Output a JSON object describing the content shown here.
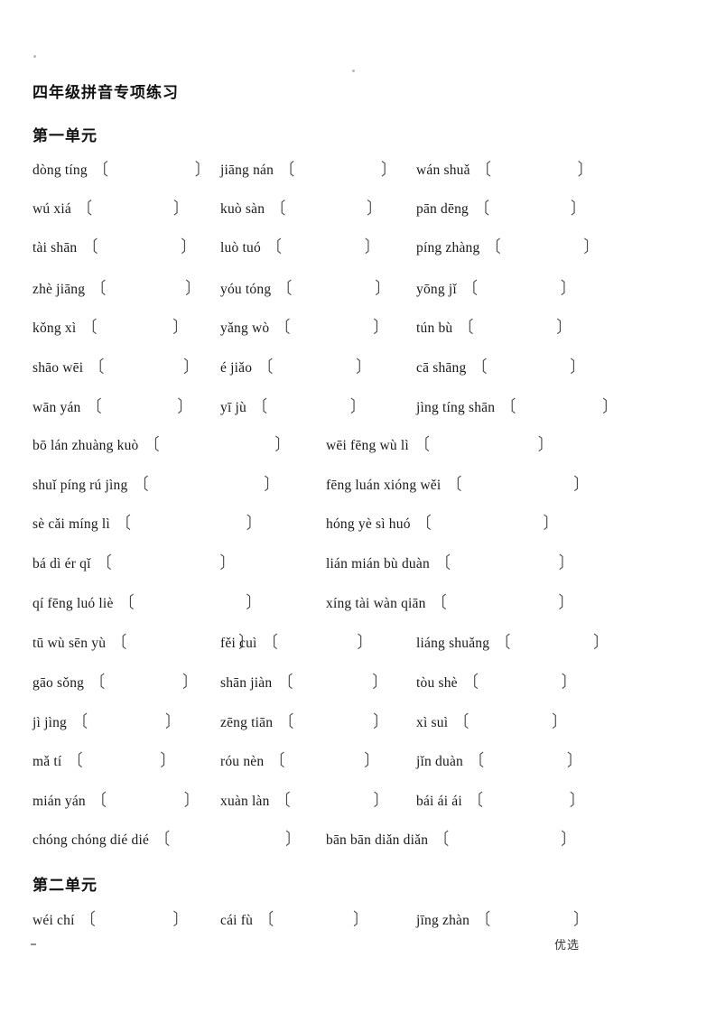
{
  "document": {
    "title": "四年级拼音专项练习",
    "footer_mark": "优选",
    "bracket_left": "〔",
    "bracket_right": "〕"
  },
  "units": [
    {
      "heading": "第一单元"
    },
    {
      "heading": "第二单元"
    }
  ],
  "rows": [
    {
      "items": [
        {
          "pinyin": "dòng tíng",
          "blank_width": 96
        },
        {
          "pinyin": "jiāng nán",
          "blank_width": 96
        },
        {
          "pinyin": "wán shuǎ",
          "blank_width": 96
        }
      ]
    },
    {
      "items": [
        {
          "pinyin": "wú xiá",
          "blank_width": 90
        },
        {
          "pinyin": "kuò sàn",
          "blank_width": 90
        },
        {
          "pinyin": "pān dēng",
          "blank_width": 90
        }
      ]
    },
    {
      "items": [
        {
          "pinyin": "tài shān",
          "blank_width": 92
        },
        {
          "pinyin": "luò tuó",
          "blank_width": 92
        },
        {
          "pinyin": "píng zhàng",
          "blank_width": 92
        }
      ]
    },
    {
      "items": [
        {
          "pinyin": "zhè jiāng",
          "blank_width": 88
        },
        {
          "pinyin": "yóu tóng",
          "blank_width": 92
        },
        {
          "pinyin": "yōng jǐ",
          "blank_width": 92
        }
      ]
    },
    {
      "items": [
        {
          "pinyin": "kǒng xì",
          "blank_width": 84
        },
        {
          "pinyin": "yǎng wò",
          "blank_width": 92
        },
        {
          "pinyin": "tún bù",
          "blank_width": 92
        }
      ]
    },
    {
      "items": [
        {
          "pinyin": "shāo wēi",
          "blank_width": 88
        },
        {
          "pinyin": "é jiǎo",
          "blank_width": 92
        },
        {
          "pinyin": "cā shāng",
          "blank_width": 92
        }
      ]
    },
    {
      "items": [
        {
          "pinyin": "wān yán",
          "blank_width": 84
        },
        {
          "pinyin": "yī jù",
          "blank_width": 92
        },
        {
          "pinyin": "jìng tíng shān",
          "blank_width": 96
        }
      ]
    },
    {
      "items": [
        {
          "pinyin": "bō lán zhuàng kuò",
          "blank_width": 128
        },
        {
          "pinyin": "wēi fēng wù lì",
          "blank_width": 120
        }
      ]
    },
    {
      "items": [
        {
          "pinyin": "shuǐ píng rú jìng",
          "blank_width": 128
        },
        {
          "pinyin": "fēng luán xióng wěi",
          "blank_width": 124
        }
      ]
    },
    {
      "items": [
        {
          "pinyin": "sè cǎi míng lì",
          "blank_width": 128
        },
        {
          "pinyin": "hóng yè sì huó",
          "blank_width": 124
        }
      ]
    },
    {
      "items": [
        {
          "pinyin": "bá dì ér qǐ",
          "blank_width": 120
        },
        {
          "pinyin": "lián mián bù duàn",
          "blank_width": 120
        }
      ]
    },
    {
      "items": [
        {
          "pinyin": "qí fēng luó liè",
          "blank_width": 124
        },
        {
          "pinyin": "xíng tài wàn qiān",
          "blank_width": 124
        }
      ]
    },
    {
      "items": [
        {
          "pinyin": "tū wù sēn yù",
          "blank_width": 124
        },
        {
          "pinyin": "fěi cuì",
          "blank_width": 88
        },
        {
          "pinyin": "liáng shuǎng",
          "blank_width": 92
        }
      ]
    },
    {
      "items": [
        {
          "pinyin": "gāo sǒng",
          "blank_width": 86
        },
        {
          "pinyin": "shān jiàn",
          "blank_width": 88
        },
        {
          "pinyin": "tòu shè",
          "blank_width": 92
        }
      ]
    },
    {
      "items": [
        {
          "pinyin": "jì jìng",
          "blank_width": 86
        },
        {
          "pinyin": "zēng tiān",
          "blank_width": 88
        },
        {
          "pinyin": "xì suì",
          "blank_width": 92
        }
      ]
    },
    {
      "items": [
        {
          "pinyin": "mǎ tí",
          "blank_width": 86
        },
        {
          "pinyin": "róu nèn",
          "blank_width": 88
        },
        {
          "pinyin": "jǐn duàn",
          "blank_width": 92
        }
      ]
    },
    {
      "items": [
        {
          "pinyin": "mián yán",
          "blank_width": 86
        },
        {
          "pinyin": "xuàn làn",
          "blank_width": 92
        },
        {
          "pinyin": "bái ái ái",
          "blank_width": 96
        }
      ]
    },
    {
      "items": [
        {
          "pinyin": "chóng chóng dié dié",
          "blank_width": 128
        },
        {
          "pinyin": "bān bān diǎn diǎn",
          "blank_width": 124
        }
      ]
    },
    {
      "items": [
        {
          "pinyin": "wéi chí",
          "blank_width": 86
        },
        {
          "pinyin": "cái fù",
          "blank_width": 88
        },
        {
          "pinyin": "jīng zhàn",
          "blank_width": 92
        }
      ]
    }
  ],
  "layout": {
    "row_tops": [
      180,
      223,
      266,
      312,
      355,
      399,
      443,
      485,
      529,
      572,
      616,
      660,
      704,
      748,
      792,
      835,
      879,
      922,
      1011
    ],
    "heading_tops": [
      136,
      966
    ],
    "row_unit_index": [
      0,
      0,
      0,
      0,
      0,
      0,
      0,
      0,
      0,
      0,
      0,
      0,
      0,
      0,
      0,
      0,
      0,
      0,
      1
    ],
    "col_lefts_3": [
      0,
      208,
      425
    ],
    "col_lefts_2": [
      0,
      325
    ]
  }
}
